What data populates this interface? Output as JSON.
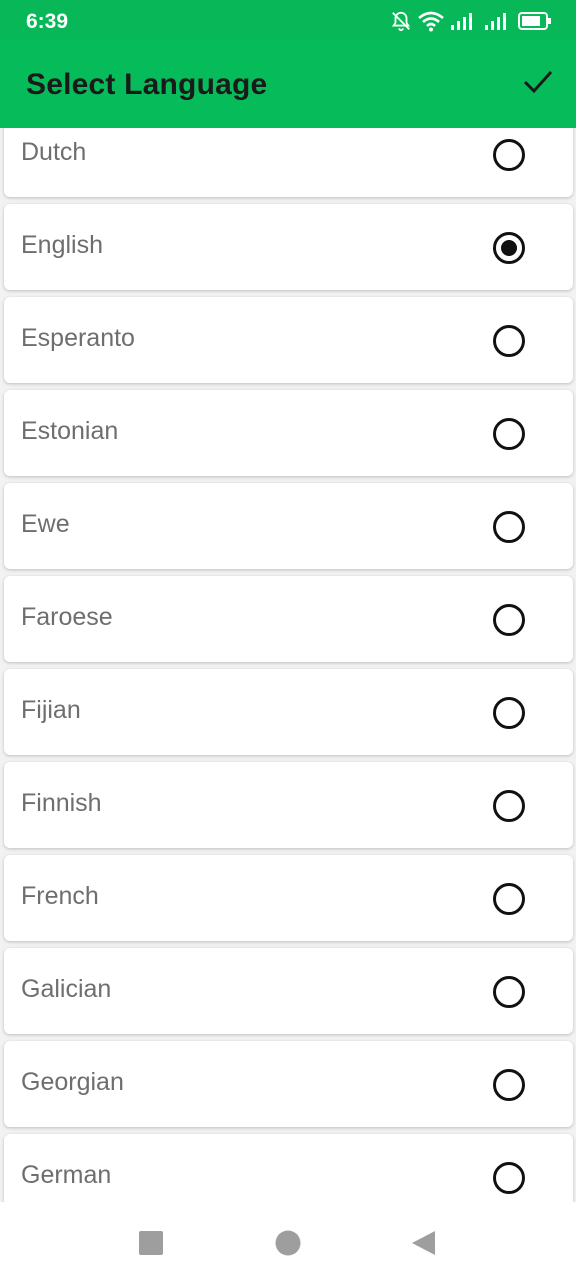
{
  "status_bar": {
    "time": "6:39",
    "icons": [
      "bell-off-icon",
      "wifi-icon",
      "signal-icon",
      "signal-icon",
      "battery-icon"
    ]
  },
  "app_bar": {
    "title": "Select Language",
    "confirm_icon": "check-icon",
    "background": "#06bc5a"
  },
  "languages": [
    {
      "label": "Dutch",
      "selected": false
    },
    {
      "label": "English",
      "selected": true
    },
    {
      "label": "Esperanto",
      "selected": false
    },
    {
      "label": "Estonian",
      "selected": false
    },
    {
      "label": "Ewe",
      "selected": false
    },
    {
      "label": "Faroese",
      "selected": false
    },
    {
      "label": "Fijian",
      "selected": false
    },
    {
      "label": "Finnish",
      "selected": false
    },
    {
      "label": "French",
      "selected": false
    },
    {
      "label": "Galician",
      "selected": false
    },
    {
      "label": "Georgian",
      "selected": false
    },
    {
      "label": "German",
      "selected": false
    }
  ],
  "nav_bar": {
    "buttons": [
      "recents-square-icon",
      "home-circle-icon",
      "back-triangle-icon"
    ]
  }
}
